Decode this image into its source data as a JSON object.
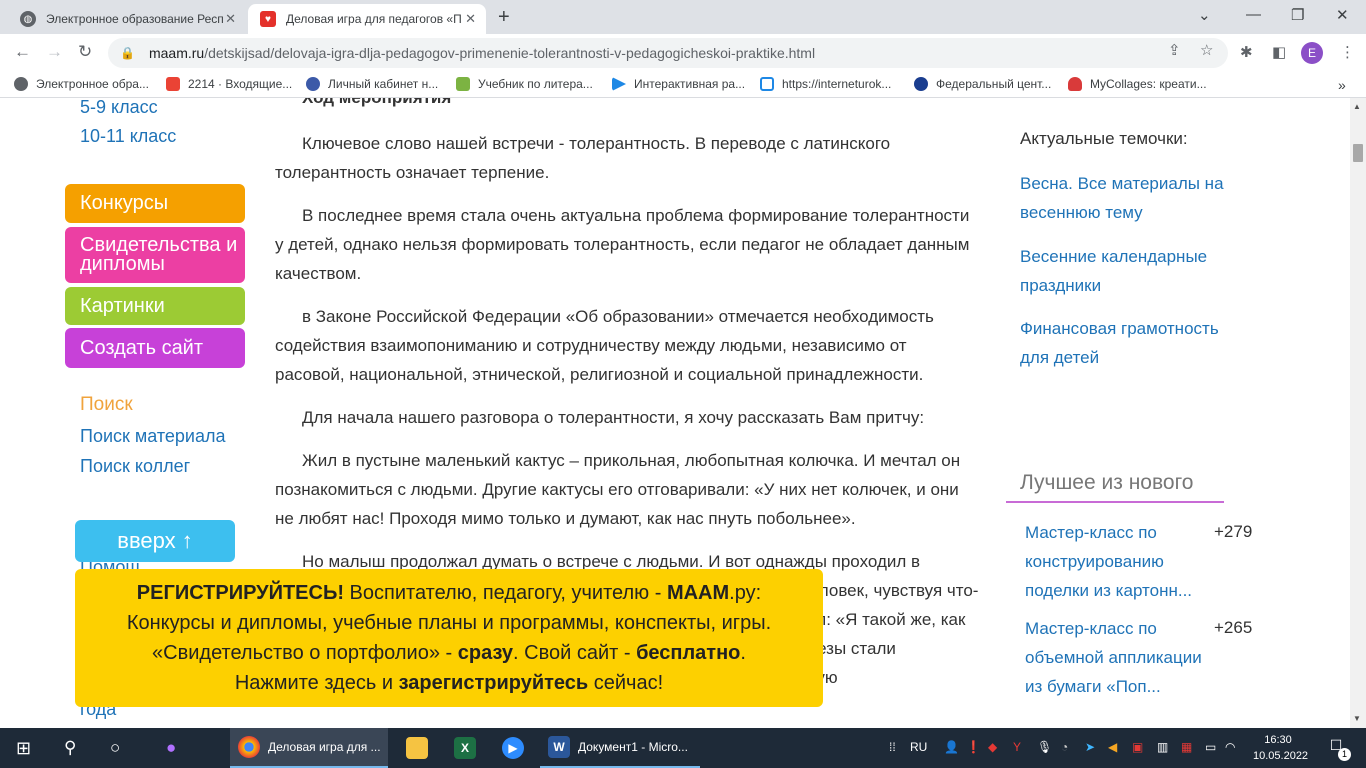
{
  "browser": {
    "tabs": [
      {
        "title": "Электронное образование Респ",
        "active": false
      },
      {
        "title": "Деловая игра для педагогов «П",
        "active": true
      }
    ],
    "url": {
      "host": "maam.ru",
      "path": "/detskijsad/delovaja-igra-dlja-pedagogov-primenenie-tolerantnosti-v-pedagogicheskoi-praktike.html"
    },
    "profile_initial": "E",
    "bookmarks": [
      {
        "label": "Электронное обра...",
        "icon": "globe-icon",
        "color": "#5f6368"
      },
      {
        "label": "2214 · Входящие...",
        "icon": "gmail-icon",
        "color": "#ea4335"
      },
      {
        "label": "Личный кабинет н...",
        "icon": "emblem-icon",
        "color": "#3c5aa8"
      },
      {
        "label": "Учебник по литера...",
        "icon": "book-icon",
        "color": "#7cb342"
      },
      {
        "label": "Интерактивная ра...",
        "icon": "play-icon",
        "color": "#1e88e5"
      },
      {
        "label": "https://interneturok...",
        "icon": "video-icon",
        "color": "#1e88e5"
      },
      {
        "label": "Федеральный цент...",
        "icon": "fcior-icon",
        "color": "#1a3d8f"
      },
      {
        "label": "MyCollages: креати...",
        "icon": "heart-icon",
        "color": "#d93a3a"
      }
    ],
    "more_bookmarks": "»"
  },
  "left_sidebar": {
    "grade_links": [
      "5-9 класс",
      "10-11 класс"
    ],
    "menu_buttons": [
      {
        "label": "Конкурсы",
        "color": "#f5a000"
      },
      {
        "label": "Свидетельства и дипломы",
        "color": "#ec3fa3"
      },
      {
        "label": "Картинки",
        "color": "#9ccb34"
      },
      {
        "label": "Создать сайт",
        "color": "#c741d8"
      }
    ],
    "search_title": "Поиск",
    "search_links": [
      "Поиск материала",
      "Поиск коллег"
    ],
    "up_button": "вверх ↑",
    "partial_text_top": "Помощ",
    "partial_text_bottom": "года"
  },
  "article": {
    "partial_heading": "Ход мероприятия",
    "paragraphs": [
      "Ключевое слово нашей встречи - толерантность. В переводе с латинского толерантность означает терпение.",
      "В последнее время стала очень актуальна проблема формирование толерантности у детей, однако нельзя формировать толерантность, если педагог не обладает данным качеством.",
      "в Законе Российской Федерации «Об образовании» отмечается необходимость содействия взаимопониманию и сотрудничеству между людьми, независимо от расовой, национальной, этнической, религиозной и социальной принадлежности.",
      "Для начала нашего разговора о толерантности, я хочу рассказать Вам притчу:",
      "Жил в пустыне маленький кактус – прикольная, любопытная колючка. И мечтал он познакомиться с людьми. Другие кактусы его отговаривали: «У них нет колючек, и они не любят нас! Проходя мимо только и думают, как нас пнуть побольнее».",
      "Но малыш продолжал думать о встрече с людьми. И вот однажды проходил в пустыне человек. Кактус старался стать как можно незаметнее. И человек, чувствуя что-то неладное, огляделся, готовая к знакомству. Кактус-малыш ответил: «Я такой же, как ты, удалец, как и ты». Тогда человек заплакал, и везде вокруг его слезы стали превращаться в прекрасный цветок. Обернулся человек, увидел такую"
    ]
  },
  "right_sidebar": {
    "topics_title": "Актуальные темочки:",
    "topics": [
      "Весна. Все материалы на весеннюю тему",
      "Весенние календарные праздники",
      "Финансовая грамотность для детей"
    ],
    "best_title": "Лучшее из нового",
    "best_items": [
      {
        "title": "Мастер-класс по конструированию поделки из картонн...",
        "count": "+279"
      },
      {
        "title": "Мастер-класс по объемной аппликации из бумаги «Поп...",
        "count": "+265"
      }
    ]
  },
  "banner": {
    "l1_bold": "РЕГИСТРИРУЙТЕСЬ!",
    "l1_text": " Воспитателю, педагогу, учителю - ",
    "l1_brand": "МААМ",
    "l1_end": ".ру:",
    "l2": "Конкурсы и дипломы, учебные планы и программы, конспекты, игры.",
    "l3_a": "«Свидетельство о портфолио» - ",
    "l3_b": "сразу",
    "l3_c": ". Свой сайт - ",
    "l3_d": "бесплатно",
    "l3_e": ".",
    "l4_a": "Нажмите здесь и ",
    "l4_b": "зарегистрируйтесь",
    "l4_c": " сейчас!"
  },
  "taskbar": {
    "apps": [
      {
        "label": "Деловая игра для ...",
        "icon": "chrome-icon",
        "active": true
      },
      {
        "label": "",
        "icon": "folder-icon",
        "active": false
      },
      {
        "label": "",
        "icon": "excel-icon",
        "active": false
      },
      {
        "label": "",
        "icon": "zoom-icon",
        "active": false
      },
      {
        "label": "Документ1 - Micro...",
        "icon": "word-icon",
        "active": false
      }
    ],
    "language": "RU",
    "time": "16:30",
    "date": "10.05.2022",
    "notifications_count": "1"
  },
  "colors": {
    "link": "#1f73b7",
    "search_heading": "#f0a33c",
    "banner_bg": "#fdd000",
    "up_button_bg": "#3dbfef",
    "best_underline": "#c86bd6"
  }
}
